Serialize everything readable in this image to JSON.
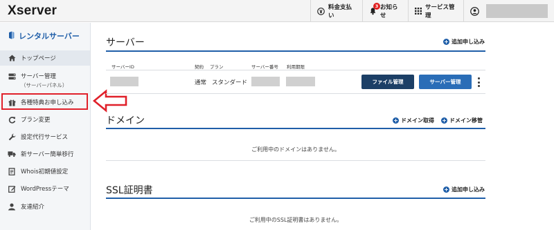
{
  "header": {
    "logo": "Xserver",
    "pay_label": "料金支払い",
    "news_label": "お知らせ",
    "news_badge": "3",
    "service_label": "サービス管理"
  },
  "sidebar": {
    "title": "レンタルサーバー",
    "items": [
      {
        "label": "トップページ",
        "icon": "home-icon"
      },
      {
        "label": "サーバー管理",
        "sub": "（サーバーパネル）",
        "icon": "server-icon"
      },
      {
        "label": "各種特典お申し込み",
        "icon": "gift-icon"
      },
      {
        "label": "プラン変更",
        "icon": "refresh-icon"
      },
      {
        "label": "設定代行サービス",
        "icon": "wrench-icon"
      },
      {
        "label": "新サーバー簡単移行",
        "icon": "truck-icon"
      },
      {
        "label": "Whois初期値設定",
        "icon": "document-icon"
      },
      {
        "label": "WordPressテーマ",
        "icon": "edit-icon"
      },
      {
        "label": "友達紹介",
        "icon": "user-icon"
      }
    ]
  },
  "server": {
    "title": "サーバー",
    "add_label": "追加申し込み",
    "columns": [
      "サーバーID",
      "契約",
      "プラン",
      "サーバー番号",
      "利用期限"
    ],
    "row": {
      "contract": "通常",
      "plan": "スタンダード"
    },
    "file_button": "ファイル管理",
    "server_button": "サーバー管理"
  },
  "domain": {
    "title": "ドメイン",
    "get_label": "ドメイン取得",
    "transfer_label": "ドメイン移管",
    "empty_text": "ご利用中のドメインはありません。"
  },
  "ssl": {
    "title": "SSL証明書",
    "add_label": "追加申し込み",
    "empty_text": "ご利用中のSSL証明書はありません。"
  },
  "colors": {
    "accent": "#1f5ea8",
    "dark_button": "#1c3f66",
    "highlight": "#e0202a"
  }
}
